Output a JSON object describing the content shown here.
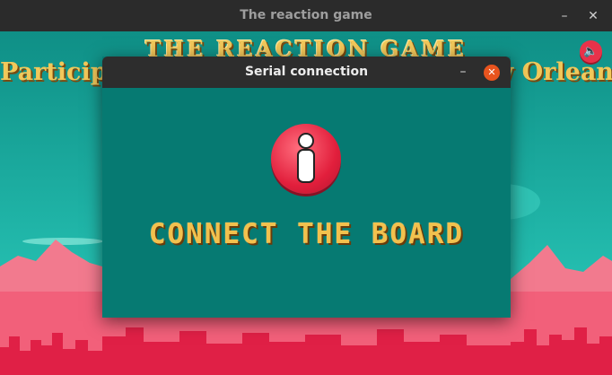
{
  "window": {
    "title": "The reaction game"
  },
  "game": {
    "title": "THE REACTION GAME",
    "subtitle": "Participation of the University of New Orleans",
    "sound_icon": "speaker-icon"
  },
  "dialog": {
    "title": "Serial connection",
    "icon": "info-icon",
    "message": "CONNECT THE BOARD"
  },
  "colors": {
    "accent": "#e8324a",
    "dialog_bg": "#067a72",
    "text_gold": "#f2c14e",
    "close_orange": "#e9541e"
  }
}
